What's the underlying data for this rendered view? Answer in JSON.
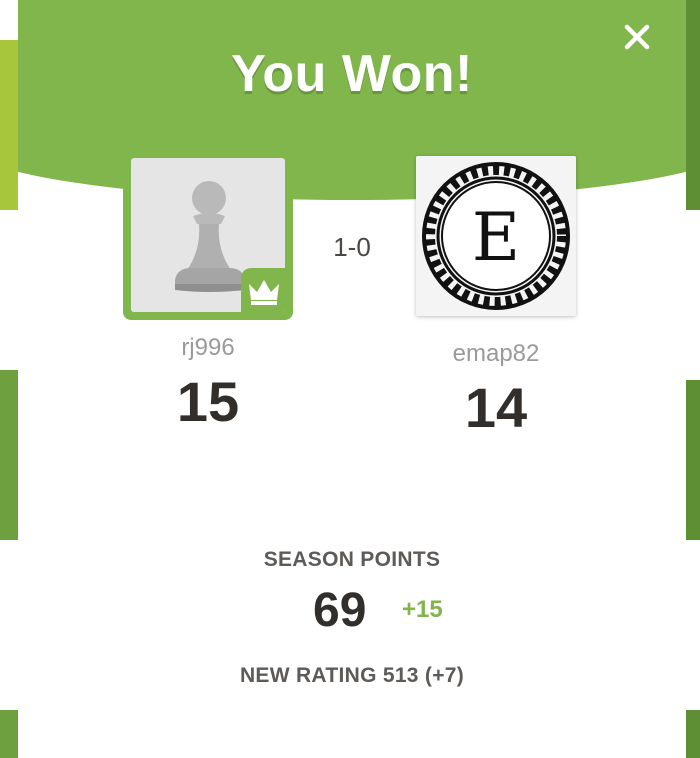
{
  "title": "You Won!",
  "result": "1-0",
  "players": [
    {
      "username": "rj996",
      "score": "15",
      "winner": true,
      "avatar": "pawn-avatar"
    },
    {
      "username": "emap82",
      "score": "14",
      "winner": false,
      "avatar": "letter-e-avatar",
      "avatar_letter": "E"
    }
  ],
  "season": {
    "label": "SEASON POINTS",
    "points": "69",
    "delta": "+15"
  },
  "rating_text": "NEW RATING 513 (+7)",
  "icons": {
    "close": "close-icon",
    "crown": "crown-icon"
  },
  "colors": {
    "accent_green": "#81b64c",
    "text_dark": "#312e2b",
    "text_muted": "#9a9a9a"
  }
}
